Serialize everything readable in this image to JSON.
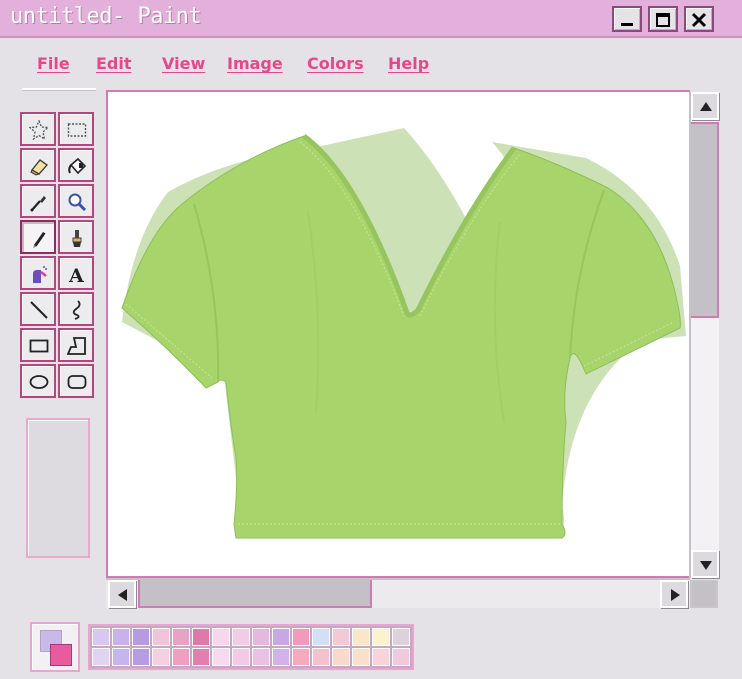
{
  "window": {
    "title": "untitled- Paint"
  },
  "menu": {
    "file": "File",
    "edit": "Edit",
    "view": "View",
    "image": "Image",
    "colors": "Colors",
    "help": "Help"
  },
  "tools": [
    {
      "id": "free-form-select",
      "icon": "star-select-icon"
    },
    {
      "id": "rect-select",
      "icon": "rect-select-icon"
    },
    {
      "id": "eraser",
      "icon": "eraser-icon"
    },
    {
      "id": "fill",
      "icon": "paint-bucket-icon"
    },
    {
      "id": "pick-color",
      "icon": "eyedropper-icon"
    },
    {
      "id": "magnifier",
      "icon": "magnifier-icon"
    },
    {
      "id": "pencil",
      "icon": "pencil-icon",
      "selected": true
    },
    {
      "id": "brush",
      "icon": "brush-icon"
    },
    {
      "id": "airbrush",
      "icon": "airbrush-icon"
    },
    {
      "id": "text",
      "icon": "text-icon"
    },
    {
      "id": "line",
      "icon": "line-icon"
    },
    {
      "id": "curve",
      "icon": "curve-icon"
    },
    {
      "id": "rectangle",
      "icon": "rectangle-icon"
    },
    {
      "id": "polygon",
      "icon": "polygon-icon"
    },
    {
      "id": "ellipse",
      "icon": "ellipse-icon"
    },
    {
      "id": "rounded-rect",
      "icon": "rounded-rectangle-icon"
    }
  ],
  "canvas": {
    "content": "green v-neck crop t-shirt",
    "shirt_color": "#a9d66e"
  },
  "scroll": {
    "vertical_position": 0.0,
    "horizontal_position": 0.0
  },
  "colors": {
    "primary": "#c9b8ea",
    "secondary": "#e85b9e",
    "accent": "#e4488a",
    "titlebar": "#e2b0da",
    "palette": [
      "#d8c8f0",
      "#c9b2ec",
      "#b79ae2",
      "#f2c4da",
      "#e9a2c4",
      "#dc7aa8",
      "#f7d6ee",
      "#f2cce6",
      "#e6b8e0",
      "#c8a8e4",
      "#f29abb",
      "#d2e0f6",
      "#f3c9d6",
      "#fae7c8",
      "#fbf2cf",
      "#ddd2dc",
      "#e0d4f2",
      "#c6b4ec",
      "#b79ce4",
      "#f6cfe2",
      "#ee9fc2",
      "#e07fb0",
      "#f8daf0",
      "#f4c8e8",
      "#eac0e6",
      "#d1b2ea",
      "#f7a9be",
      "#f4c2cc",
      "#f8d9cc",
      "#fae0c8",
      "#f9d3d9",
      "#f1c8dc"
    ]
  }
}
